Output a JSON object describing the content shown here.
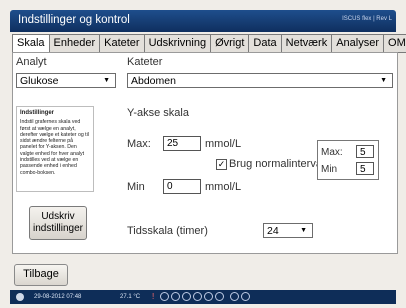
{
  "window": {
    "title": "Indstillinger og kontrol",
    "brand": "ISCUS flex | Rev L"
  },
  "tabs": [
    "Skala",
    "Enheder",
    "Kateter",
    "Udskrivning",
    "Øvrigt",
    "Data",
    "Netværk",
    "Analyser",
    "OM"
  ],
  "active_tab": "Skala",
  "analyte": {
    "label": "Analyt",
    "value": "Glukose"
  },
  "catheter": {
    "label": "Kateter",
    "value": "Abdomen"
  },
  "info": {
    "heading": "Indstillinger",
    "text": "Indstil grafernes skala ved først at vælge en analyt, derefter vælge et kateter og til sidst ændre felterne på panelet for Y-aksen. Den valgte enhed for hver analyt indstilles ved at vælge en passende enhed i enhed combo-boksen."
  },
  "print_button": {
    "label": "Udskriv indstillinger"
  },
  "y_axis": {
    "label": "Y-akse skala",
    "max_label": "Max:",
    "max_value": "25",
    "max_unit": "mmol/L",
    "min_label": "Min",
    "min_value": "0",
    "min_unit": "mmol/L",
    "normal_interval_label": "Brug normalinterval",
    "normal_interval_checked": true
  },
  "normal_range": {
    "max_label": "Max:",
    "max_value": "5",
    "min_label": "Min",
    "min_value": "5"
  },
  "time_scale": {
    "label": "Tidsskala (timer)",
    "value": "24"
  },
  "footer": {
    "back_label": "Tilbage"
  },
  "status": {
    "datetime": "29-08-2012 07:48",
    "temperature": "27.1 °C"
  }
}
